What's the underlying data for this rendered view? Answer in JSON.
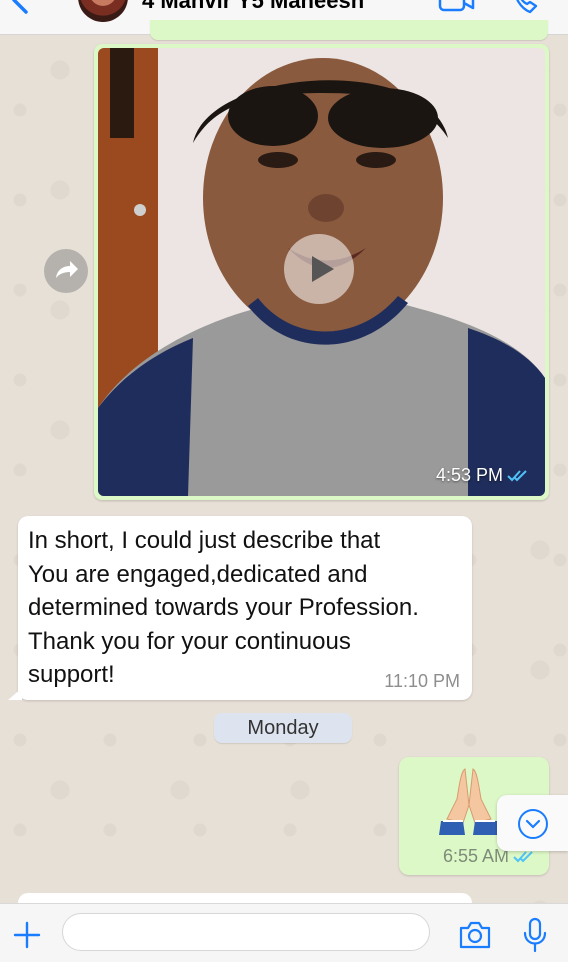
{
  "header": {
    "title": "4 Manvir Y5 Maneesh",
    "accent_color": "#1a7dff"
  },
  "video_message": {
    "time": "4:53 PM",
    "status": "read",
    "tick_color": "#4fc3f7"
  },
  "incoming_message": {
    "lines": [
      "In short, I could just describe that",
      "You are engaged,dedicated and",
      "determined towards your Profession.",
      "Thank you for your continuous",
      "support!"
    ],
    "time": "11:10 PM"
  },
  "date_separator": {
    "label": "Monday"
  },
  "outgoing_message": {
    "emoji": "folded-hands-icon",
    "time": "6:55 AM",
    "status": "read"
  },
  "composer": {
    "input_value": "",
    "placeholder": ""
  },
  "colors": {
    "outgoing_bubble": "#dcf8c6",
    "incoming_bubble": "#ffffff",
    "date_chip": "#dde4ef",
    "wallpaper": "#e7e0d6"
  }
}
